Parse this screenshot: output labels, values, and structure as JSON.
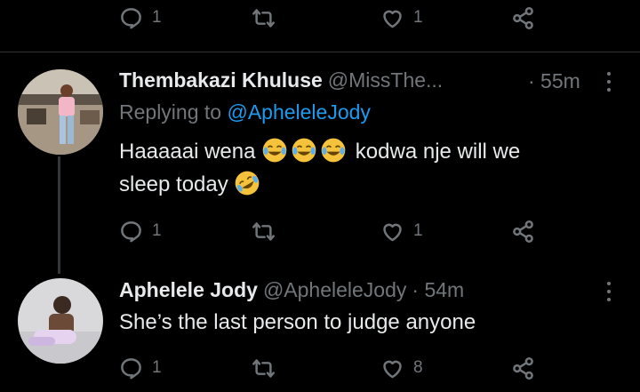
{
  "top_tweet_actions": {
    "reply_count": "1",
    "retweet_count": "",
    "like_count": "1"
  },
  "tweet1": {
    "name": "Thembakazi Khuluse",
    "handle": "@MissThe...",
    "time": "· 55m",
    "replying_prefix": "Replying to",
    "replying_to": "@ApheleleJody",
    "text_before_emoji": "Haaaaai wena",
    "text_after_emoji": "kodwa nje will we",
    "text_line2": "sleep today",
    "actions": {
      "reply_count": "1",
      "retweet_count": "",
      "like_count": "1"
    }
  },
  "tweet2": {
    "name": "Aphelele Jody",
    "handle": "@ApheleleJody",
    "time": "· 54m",
    "text": "She’s the last person to judge anyone",
    "actions": {
      "reply_count": "1",
      "retweet_count": "",
      "like_count": "8"
    }
  },
  "icons": {
    "reply": "reply-icon",
    "retweet": "retweet-icon",
    "like": "heart-icon",
    "share": "share-icon",
    "more": "more-vertical-icon",
    "emoji_joy": "tears-of-joy-emoji",
    "emoji_rofl": "rolling-on-floor-laughing-emoji"
  },
  "colors": {
    "background": "#000000",
    "text": "#e7e9ea",
    "secondary": "#71767b",
    "link": "#1d9bf0"
  }
}
